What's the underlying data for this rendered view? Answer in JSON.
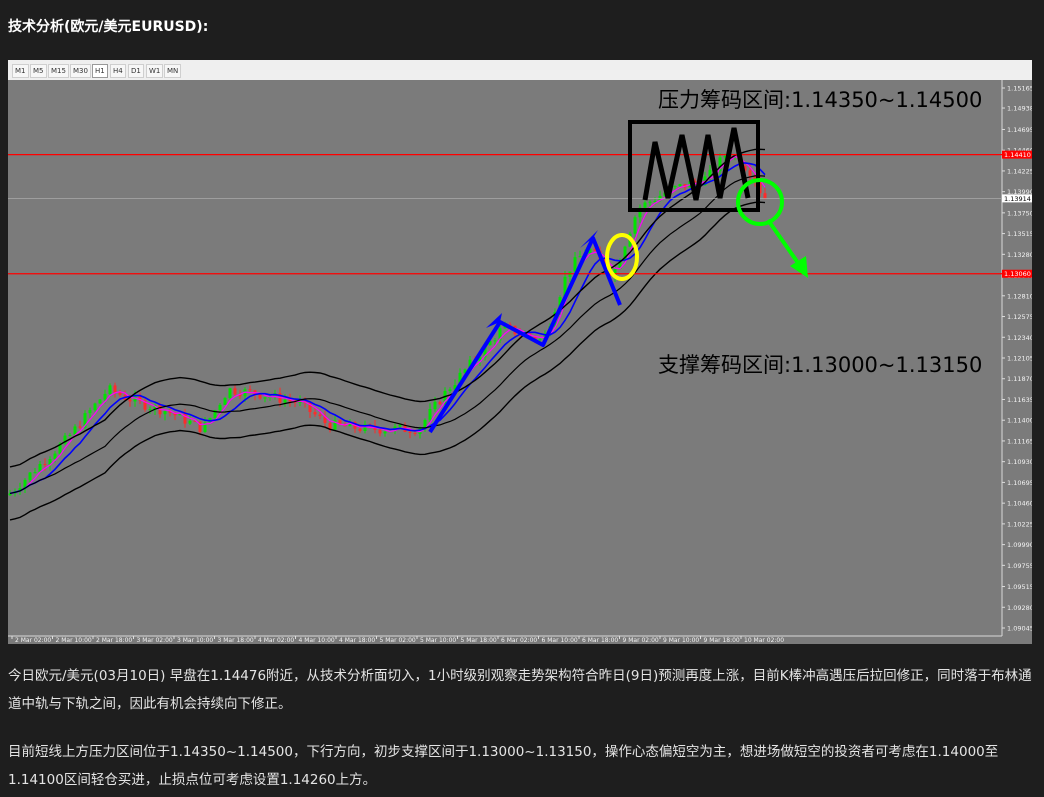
{
  "heading": "技术分析(欧元/美元EURUSD):",
  "timeframes": [
    "M1",
    "M5",
    "M15",
    "M30",
    "H1",
    "H4",
    "D1",
    "W1",
    "MN"
  ],
  "active_timeframe": "H1",
  "chart": {
    "resistance_label": "压力筹码区间:1.14350~1.14500",
    "support_label": "支撑筹码区间:1.13000~1.13150",
    "pattern_label": "M",
    "price_ticks": [
      "1.15165",
      "1.14938",
      "1.14695",
      "1.14460",
      "1.14225",
      "1.13990",
      "1.13750",
      "1.13515",
      "1.13280",
      "1.13040",
      "1.12810",
      "1.12575",
      "1.12340",
      "1.12105",
      "1.11870",
      "1.11635",
      "1.11400",
      "1.11165",
      "1.10930",
      "1.10695",
      "1.10460",
      "1.10225",
      "1.09990",
      "1.09755",
      "1.09515",
      "1.09280",
      "1.09045"
    ],
    "time_ticks": [
      "2 Mar 02:00",
      "2 Mar 10:00",
      "2 Mar 18:00",
      "3 Mar 02:00",
      "3 Mar 10:00",
      "3 Mar 18:00",
      "4 Mar 02:00",
      "4 Mar 10:00",
      "4 Mar 18:00",
      "5 Mar 02:00",
      "5 Mar 10:00",
      "5 Mar 18:00",
      "6 Mar 02:00",
      "6 Mar 10:00",
      "6 Mar 18:00",
      "9 Mar 02:00",
      "9 Mar 10:00",
      "9 Mar 18:00",
      "10 Mar 02:00"
    ],
    "current_price": "1.13914",
    "resistance_line_price": "1.14410",
    "support_line_price": "1.13060",
    "colors": {
      "bull": "#00e400",
      "bear": "#ff2a2a",
      "band": "#000000",
      "ma": "#0000ff",
      "line_red": "#ff0000",
      "annot_blue": "#0000ff",
      "annot_yellow": "#ffff00",
      "annot_green": "#00ff00"
    }
  },
  "paragraphs": [
    "今日欧元/美元(03月10日) 早盘在1.14476附近，从技术分析面切入，1小时级别观察走势架构符合昨日(9日)预测再度上涨，目前K棒冲高遇压后拉回修正，同时落于布林通道中轨与下轨之间，因此有机会持续向下修正。",
    "目前短线上方压力区间位于1.14350~1.14500，下行方向，初步支撑区间于1.13000~1.13150，操作心态偏短空为主，想进场做短空的投资者可考虑在1.14000至1.14100区间轻仓买进，止损点位可考虑设置1.14260上方。"
  ]
}
